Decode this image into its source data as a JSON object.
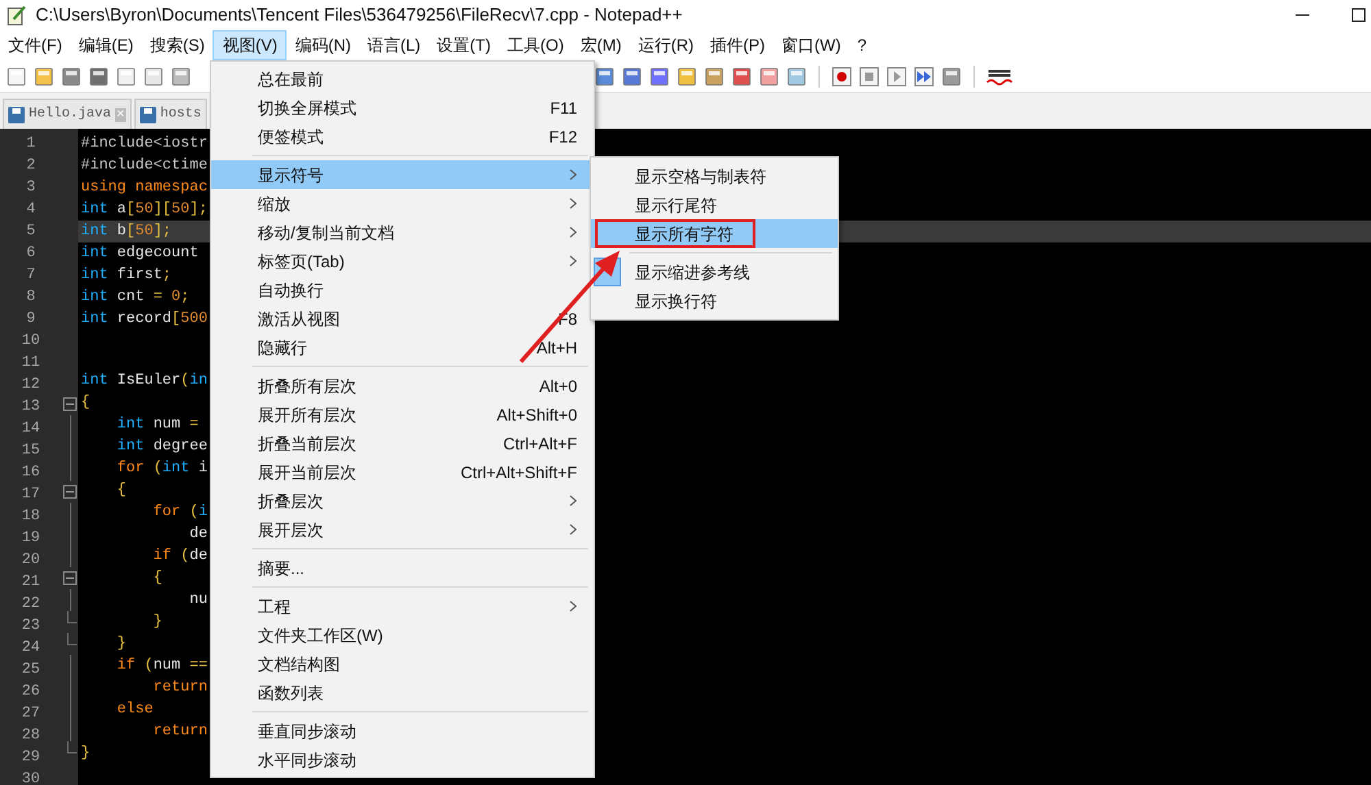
{
  "window": {
    "title": "C:\\Users\\Byron\\Documents\\Tencent Files\\536479256\\FileRecv\\7.cpp - Notepad++"
  },
  "menu_bar": [
    {
      "label": "文件(F)",
      "selected": false
    },
    {
      "label": "编辑(E)",
      "selected": false
    },
    {
      "label": "搜索(S)",
      "selected": false
    },
    {
      "label": "视图(V)",
      "selected": true
    },
    {
      "label": "编码(N)",
      "selected": false
    },
    {
      "label": "语言(L)",
      "selected": false
    },
    {
      "label": "设置(T)",
      "selected": false
    },
    {
      "label": "工具(O)",
      "selected": false
    },
    {
      "label": "宏(M)",
      "selected": false
    },
    {
      "label": "运行(R)",
      "selected": false
    },
    {
      "label": "插件(P)",
      "selected": false
    },
    {
      "label": "窗口(W)",
      "selected": false
    },
    {
      "label": "?",
      "selected": false
    }
  ],
  "tabs": [
    {
      "label": "Hello.java",
      "close": "×"
    },
    {
      "label": "hosts"
    }
  ],
  "editor": {
    "lines": [
      {
        "number": "1",
        "current": false,
        "tokens": [
          {
            "t": "#include<iostr",
            "color": "#c8c8c8"
          }
        ]
      },
      {
        "number": "2",
        "current": false,
        "tokens": [
          {
            "t": "#include<ctime",
            "color": "#c8c8c8"
          }
        ]
      },
      {
        "number": "3",
        "current": false,
        "tokens": [
          {
            "t": "using",
            "color": "#ff8a1a"
          },
          {
            "t": " namespac",
            "color": "#ff8a1a"
          }
        ]
      },
      {
        "number": "4",
        "current": false,
        "tokens": [
          {
            "t": "int",
            "color": "#1fb0ff"
          },
          {
            "t": " a",
            "color": "#e6e6e6"
          },
          {
            "t": "[",
            "color": "#e8c040"
          },
          {
            "t": "50",
            "color": "#e08a30"
          },
          {
            "t": "][",
            "color": "#e8c040"
          },
          {
            "t": "50",
            "color": "#e08a30"
          },
          {
            "t": "];",
            "color": "#e8c040"
          }
        ]
      },
      {
        "number": "5",
        "current": true,
        "tokens": [
          {
            "t": "int",
            "color": "#1fb0ff"
          },
          {
            "t": " b",
            "color": "#e6e6e6"
          },
          {
            "t": "[",
            "color": "#e8c040"
          },
          {
            "t": "50",
            "color": "#e08a30"
          },
          {
            "t": "];",
            "color": "#e8c040"
          }
        ]
      },
      {
        "number": "6",
        "current": false,
        "tokens": [
          {
            "t": "int",
            "color": "#1fb0ff"
          },
          {
            "t": " edgecount",
            "color": "#e6e6e6"
          }
        ]
      },
      {
        "number": "7",
        "current": false,
        "tokens": [
          {
            "t": "int",
            "color": "#1fb0ff"
          },
          {
            "t": " first",
            "color": "#e6e6e6"
          },
          {
            "t": ";",
            "color": "#e8c040"
          }
        ]
      },
      {
        "number": "8",
        "current": false,
        "tokens": [
          {
            "t": "int",
            "color": "#1fb0ff"
          },
          {
            "t": " cnt ",
            "color": "#e6e6e6"
          },
          {
            "t": "=",
            "color": "#e8c040"
          },
          {
            "t": " 0",
            "color": "#e08a30"
          },
          {
            "t": ";",
            "color": "#e8c040"
          }
        ]
      },
      {
        "number": "9",
        "current": false,
        "tokens": [
          {
            "t": "int",
            "color": "#1fb0ff"
          },
          {
            "t": " record",
            "color": "#e6e6e6"
          },
          {
            "t": "[",
            "color": "#e8c040"
          },
          {
            "t": "500",
            "color": "#e08a30"
          }
        ]
      },
      {
        "number": "10",
        "current": false
      },
      {
        "number": "11",
        "current": false
      },
      {
        "number": "12",
        "current": false,
        "tokens": [
          {
            "t": "int",
            "color": "#1fb0ff"
          },
          {
            "t": " IsEuler",
            "color": "#e6e6e6"
          },
          {
            "t": "(",
            "color": "#e8c040"
          },
          {
            "t": "in",
            "color": "#1fb0ff"
          }
        ]
      },
      {
        "number": "13",
        "kind": "foldstart",
        "current": false,
        "tokens": [
          {
            "t": "{",
            "color": "#e8c040"
          }
        ]
      },
      {
        "number": "14",
        "kind": "foldbody",
        "current": false,
        "tokens": [
          {
            "t": "    int",
            "color": "#1fb0ff"
          },
          {
            "t": " num ",
            "color": "#e6e6e6"
          },
          {
            "t": "=",
            "color": "#e8c040"
          }
        ]
      },
      {
        "number": "15",
        "kind": "foldbody",
        "current": false,
        "tokens": [
          {
            "t": "    int",
            "color": "#1fb0ff"
          },
          {
            "t": " degree",
            "color": "#e6e6e6"
          }
        ]
      },
      {
        "number": "16",
        "kind": "foldbody",
        "current": false,
        "tokens": [
          {
            "t": "    for",
            "color": "#ff8a1a"
          },
          {
            "t": " (",
            "color": "#e8c040"
          },
          {
            "t": "int",
            "color": "#1fb0ff"
          },
          {
            "t": " i",
            "color": "#e6e6e6"
          }
        ]
      },
      {
        "number": "17",
        "kind": "foldstart",
        "current": false,
        "tokens": [
          {
            "t": "    {",
            "color": "#e8c040"
          }
        ]
      },
      {
        "number": "18",
        "kind": "foldbody",
        "current": false,
        "tokens": [
          {
            "t": "        for",
            "color": "#ff8a1a"
          },
          {
            "t": " (",
            "color": "#e8c040"
          },
          {
            "t": "i",
            "color": "#1fb0ff"
          }
        ]
      },
      {
        "number": "19",
        "kind": "foldbody",
        "current": false,
        "tokens": [
          {
            "t": "            de",
            "color": "#e6e6e6"
          }
        ]
      },
      {
        "number": "20",
        "kind": "foldbody",
        "current": false,
        "tokens": [
          {
            "t": "        if",
            "color": "#ff8a1a"
          },
          {
            "t": " (",
            "color": "#e8c040"
          },
          {
            "t": "de",
            "color": "#e6e6e6"
          }
        ]
      },
      {
        "number": "21",
        "kind": "foldstart",
        "current": false,
        "tokens": [
          {
            "t": "        {",
            "color": "#e8c040"
          }
        ]
      },
      {
        "number": "22",
        "kind": "foldbody",
        "current": false,
        "tokens": [
          {
            "t": "            nu",
            "color": "#e6e6e6"
          }
        ]
      },
      {
        "number": "23",
        "kind": "foldend",
        "current": false,
        "tokens": [
          {
            "t": "        }",
            "color": "#e8c040"
          }
        ]
      },
      {
        "number": "24",
        "kind": "foldend",
        "current": false,
        "tokens": [
          {
            "t": "    }",
            "color": "#e8c040"
          }
        ]
      },
      {
        "number": "25",
        "kind": "foldbody",
        "current": false,
        "tokens": [
          {
            "t": "    if",
            "color": "#ff8a1a"
          },
          {
            "t": " (",
            "color": "#e8c040"
          },
          {
            "t": "num ",
            "color": "#e6e6e6"
          },
          {
            "t": "==",
            "color": "#e8c040"
          }
        ]
      },
      {
        "number": "26",
        "kind": "foldbody",
        "current": false,
        "tokens": [
          {
            "t": "        return",
            "color": "#ff8a1a"
          }
        ]
      },
      {
        "number": "27",
        "kind": "foldbody",
        "current": false,
        "tokens": [
          {
            "t": "    else",
            "color": "#ff8a1a"
          }
        ]
      },
      {
        "number": "28",
        "kind": "foldbody",
        "current": false,
        "tokens": [
          {
            "t": "        return",
            "color": "#ff8a1a"
          }
        ]
      },
      {
        "number": "29",
        "kind": "foldend",
        "current": false,
        "tokens": [
          {
            "t": "}",
            "color": "#e8c040"
          }
        ]
      },
      {
        "number": "30",
        "current": false
      }
    ]
  },
  "view_menu": [
    {
      "kind": "item",
      "label": "总在最前",
      "selected": false
    },
    {
      "kind": "item",
      "label": "切换全屏模式",
      "shortcut": "F11",
      "selected": false
    },
    {
      "kind": "item",
      "label": "便签模式",
      "shortcut": "F12",
      "selected": false
    },
    {
      "kind": "separator"
    },
    {
      "kind": "submenu",
      "label": "显示符号",
      "selected": true
    },
    {
      "kind": "submenu",
      "label": "缩放",
      "selected": false
    },
    {
      "kind": "submenu",
      "label": "移动/复制当前文档",
      "selected": false
    },
    {
      "kind": "submenu",
      "label": "标签页(Tab)",
      "selected": false
    },
    {
      "kind": "item",
      "label": "自动换行",
      "selected": false
    },
    {
      "kind": "item",
      "label": "激活从视图",
      "shortcut": "F8",
      "selected": false
    },
    {
      "kind": "item",
      "label": "隐藏行",
      "shortcut": "Alt+H",
      "selected": false
    },
    {
      "kind": "separator"
    },
    {
      "kind": "item",
      "label": "折叠所有层次",
      "shortcut": "Alt+0",
      "selected": false
    },
    {
      "kind": "item",
      "label": "展开所有层次",
      "shortcut": "Alt+Shift+0",
      "selected": false
    },
    {
      "kind": "item",
      "label": "折叠当前层次",
      "shortcut": "Ctrl+Alt+F",
      "selected": false
    },
    {
      "kind": "item",
      "label": "展开当前层次",
      "shortcut": "Ctrl+Alt+Shift+F",
      "selected": false
    },
    {
      "kind": "submenu",
      "label": "折叠层次",
      "selected": false
    },
    {
      "kind": "submenu",
      "label": "展开层次",
      "selected": false
    },
    {
      "kind": "separator"
    },
    {
      "kind": "item",
      "label": "摘要...",
      "selected": false
    },
    {
      "kind": "separator"
    },
    {
      "kind": "submenu",
      "label": "工程",
      "selected": false
    },
    {
      "kind": "item",
      "label": "文件夹工作区(W)",
      "selected": false
    },
    {
      "kind": "item",
      "label": "文档结构图",
      "selected": false
    },
    {
      "kind": "item",
      "label": "函数列表",
      "selected": false
    },
    {
      "kind": "separator"
    },
    {
      "kind": "item",
      "label": "垂直同步滚动",
      "selected": false
    },
    {
      "kind": "item",
      "label": "水平同步滚动",
      "selected": false
    }
  ],
  "symbols_submenu": [
    {
      "kind": "item",
      "label": "显示空格与制表符",
      "selected": false,
      "checked": false
    },
    {
      "kind": "item",
      "label": "显示行尾符",
      "selected": false,
      "checked": false
    },
    {
      "kind": "item",
      "label": "显示所有字符",
      "selected": true,
      "checked": false,
      "annotated": true
    },
    {
      "kind": "separator"
    },
    {
      "kind": "item",
      "label": "显示缩进参考线",
      "selected": false,
      "checked": true
    },
    {
      "kind": "item",
      "label": "显示换行符",
      "selected": false,
      "checked": false
    }
  ]
}
